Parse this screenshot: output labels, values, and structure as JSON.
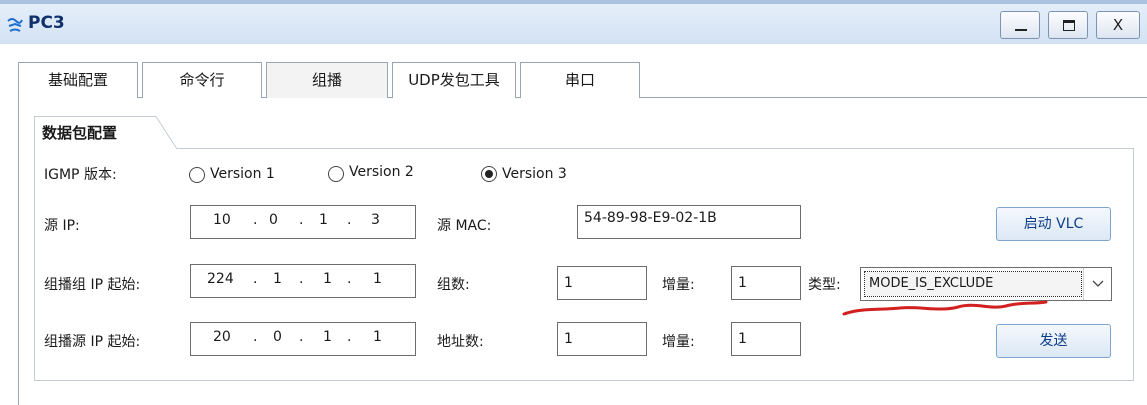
{
  "window": {
    "title": "PC3",
    "minimize_label": "_",
    "close_label": "X"
  },
  "tabs": [
    {
      "label": "基础配置",
      "active": false
    },
    {
      "label": "命令行",
      "active": false
    },
    {
      "label": "组播",
      "active": true
    },
    {
      "label": "UDP发包工具",
      "active": false
    },
    {
      "label": "串口",
      "active": false
    }
  ],
  "group": {
    "title": "数据包配置"
  },
  "igmp": {
    "label": "IGMP 版本:",
    "options": [
      {
        "label": "Version 1",
        "selected": false
      },
      {
        "label": "Version 2",
        "selected": false
      },
      {
        "label": "Version 3",
        "selected": true
      }
    ]
  },
  "source": {
    "ip_label": "源 IP:",
    "ip": [
      "10",
      "0",
      "1",
      "3"
    ],
    "mac_label": "源  MAC:",
    "mac": "54-89-98-E9-02-1B",
    "vlc_button": "启动 VLC"
  },
  "group_ip": {
    "label": "组播组 IP 起始:",
    "ip": [
      "224",
      "1",
      "1",
      "1"
    ],
    "count_label": "组数:",
    "count": "1",
    "increment_label": "增量:",
    "increment": "1",
    "type_label": "类型:",
    "type_value": "MODE_IS_EXCLUDE"
  },
  "source_ip": {
    "label": "组播源 IP 起始:",
    "ip": [
      "20",
      "0",
      "1",
      "1"
    ],
    "count_label": "地址数:",
    "count": "1",
    "increment_label": "增量:",
    "increment": "1",
    "send_button": "发送"
  },
  "ip_separator": ".",
  "colors": {
    "accent": "#0e3d8a",
    "annotation": "#d21f1f"
  }
}
